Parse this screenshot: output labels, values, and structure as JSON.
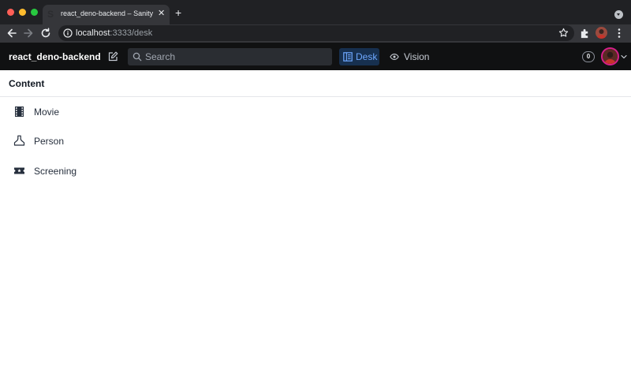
{
  "browser": {
    "tab_title": "react_deno-backend – Sanity",
    "tab_close": "✕",
    "new_tab": "+",
    "url_host": "localhost",
    "url_path": ":3333/desk"
  },
  "navbar": {
    "project_name": "react_deno-backend",
    "search_placeholder": "Search",
    "tools": [
      {
        "label": "Desk",
        "active": true
      },
      {
        "label": "Vision",
        "active": false
      }
    ],
    "notification_count": "0"
  },
  "pane": {
    "title": "Content",
    "items": [
      {
        "label": "Movie",
        "icon": "film-icon"
      },
      {
        "label": "Person",
        "icon": "user-icon"
      },
      {
        "label": "Screening",
        "icon": "ticket-icon"
      }
    ]
  },
  "colors": {
    "navbar_bg": "#101112",
    "active_tool": "#6ea8ff",
    "avatar_ring": "#d61f8a"
  }
}
